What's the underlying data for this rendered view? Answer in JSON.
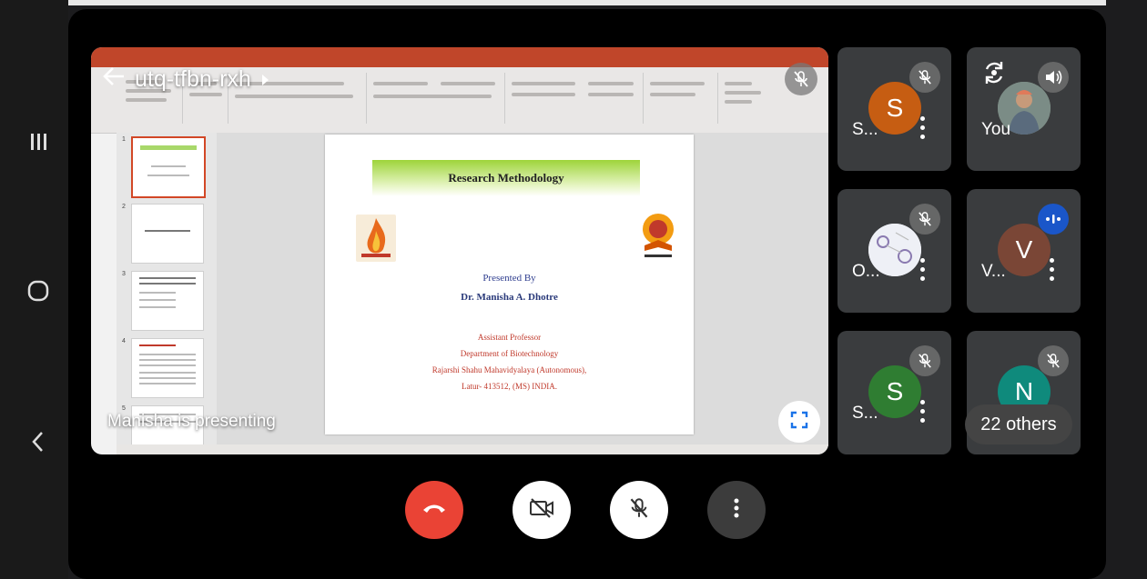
{
  "meeting": {
    "code": "utq-tfbn-rxh",
    "presenting_label": "Manisha is presenting",
    "others_label": "22 others"
  },
  "slide": {
    "title": "Research Methodology",
    "presented_by": "Presented By",
    "author": "Dr. Manisha A. Dhotre",
    "role": "Assistant Professor",
    "department": "Department of Biotechnology",
    "college": "Rajarshi Shahu Mahavidyalaya (Autonomous),",
    "address": "Latur- 413512, (MS) INDIA."
  },
  "participants": [
    {
      "initial": "S",
      "name": "S...",
      "color": "#c65d12",
      "muted": true
    },
    {
      "initial": "",
      "name": "You",
      "color": "#8a9a8a",
      "muted": false
    },
    {
      "initial": "",
      "name": "O...",
      "color": "#e8e8f0",
      "muted": true
    },
    {
      "initial": "V",
      "name": "V...",
      "color": "#7a4636",
      "muted": false
    },
    {
      "initial": "S",
      "name": "S...",
      "color": "#2f7d32",
      "muted": true
    },
    {
      "initial": "N",
      "name": "",
      "color": "#0f8a7c",
      "muted": true
    }
  ],
  "colors": {
    "end_call": "#ea4335",
    "active_speaker": "#1a56c9",
    "accent_slide": "#9ed43a"
  },
  "icons": {
    "back": "arrow-left-icon",
    "end_call": "phone-hangup-icon",
    "camera_off": "video-off-icon",
    "mic_off": "mic-off-icon",
    "more": "more-vert-icon",
    "fullscreen": "fullscreen-icon",
    "flip_camera": "flip-camera-icon",
    "speaker": "volume-icon"
  }
}
